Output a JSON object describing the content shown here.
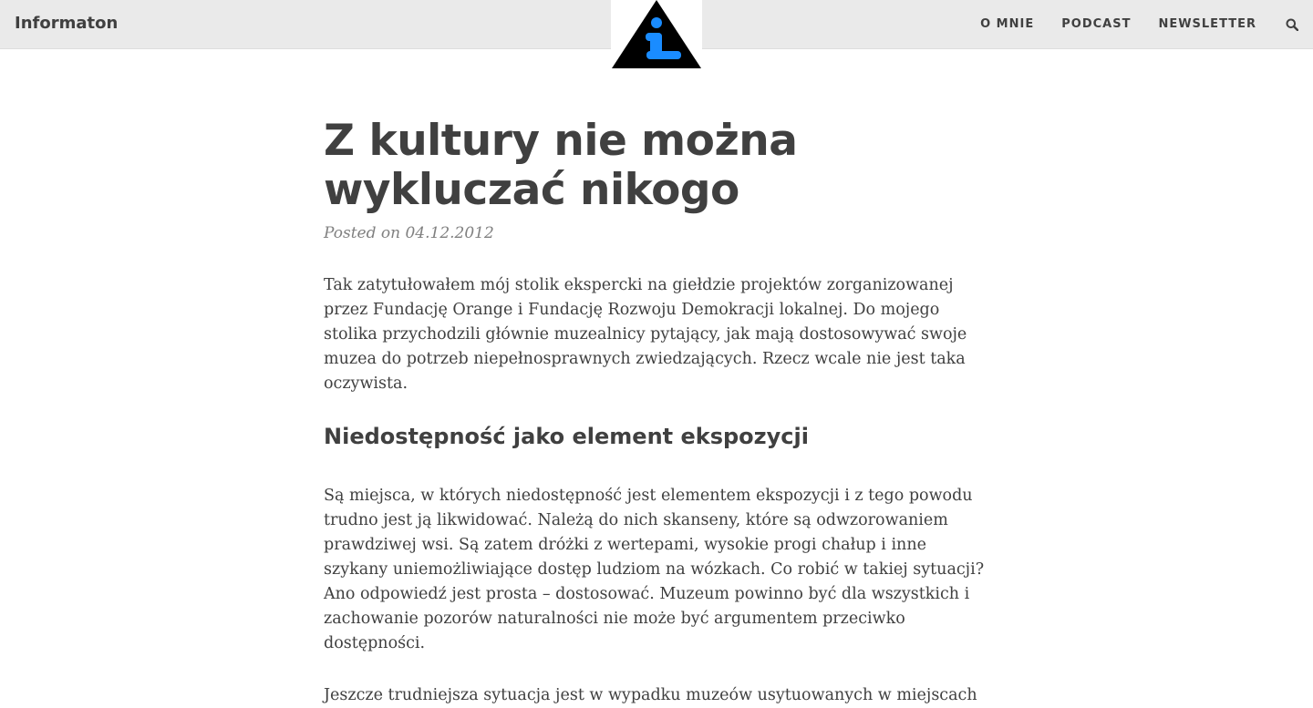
{
  "navbar": {
    "brand": "Informaton",
    "logo": "info-triangle-logo",
    "links": [
      "O MNIE",
      "PODCAST",
      "NEWSLETTER"
    ],
    "search_icon": "search-icon"
  },
  "post": {
    "title": "Z kultury nie można wykluczać nikogo",
    "meta": "Posted on 04.12.2012",
    "paragraphs": [
      "Tak zatytułowałem mój stolik ekspercki na giełdzie projektów zorganizowanej przez Fundację Orange i Fundację Rozwoju Demokracji lokalnej. Do mojego stolika przychodzili głównie muzealnicy pytający, jak mają dostosowywać swoje muzea do potrzeb niepełnosprawnych zwiedzających. Rzecz wcale nie jest taka oczywista.",
      "Są miejsca, w których niedostępność jest elementem ekspozycji i z tego powodu trudno jest ją likwidować. Należą do nich skanseny, które są odwzorowaniem prawdziwej wsi. Są zatem dróżki z wertepami, wysokie progi chałup i inne szykany uniemożliwiające dostęp ludziom na wózkach. Co robić w takiej sytuacji? Ano odpowiedź jest prosta – dostosować. Muzeum powinno być dla wszystkich i zachowanie pozorów naturalności nie może być argumentem przeciwko dostępności.",
      "Jeszcze trudniejsza sytuacja jest w wypadku muzeów usytuowanych w miejscach"
    ],
    "section_heading": "Niedostępność jako element ekspozycji"
  },
  "colors": {
    "navbar_bg": "#eaeaea",
    "text": "#404040",
    "meta": "#808080",
    "logo_blue": "#1a8cff",
    "logo_black": "#000000"
  }
}
